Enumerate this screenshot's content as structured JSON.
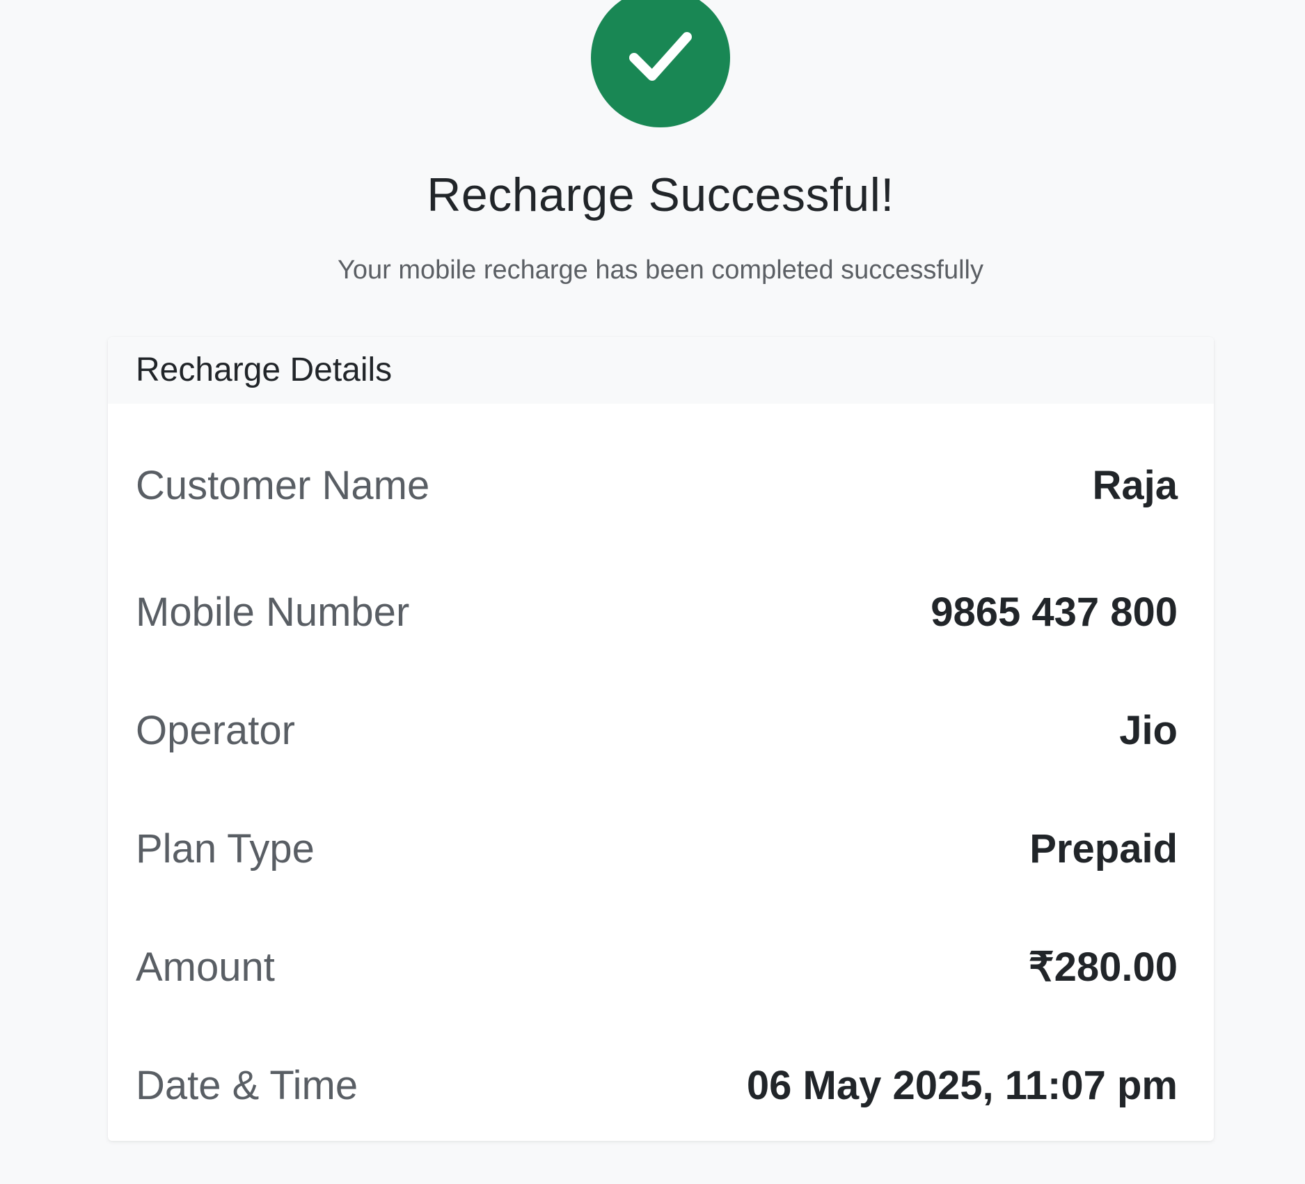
{
  "status": {
    "icon": "check-icon",
    "color": "#198754",
    "title": "Recharge Successful!",
    "subtitle": "Your mobile recharge has been completed successfully"
  },
  "details": {
    "heading": "Recharge Details",
    "rows": [
      {
        "label": "Customer Name",
        "value": "Raja"
      },
      {
        "label": "Mobile Number",
        "value": "9865 437 800"
      },
      {
        "label": "Operator",
        "value": "Jio"
      },
      {
        "label": "Plan Type",
        "value": "Prepaid"
      },
      {
        "label": "Amount",
        "value": "₹280.00"
      },
      {
        "label": "Date & Time",
        "value": "06 May 2025, 11:07 pm"
      }
    ]
  }
}
